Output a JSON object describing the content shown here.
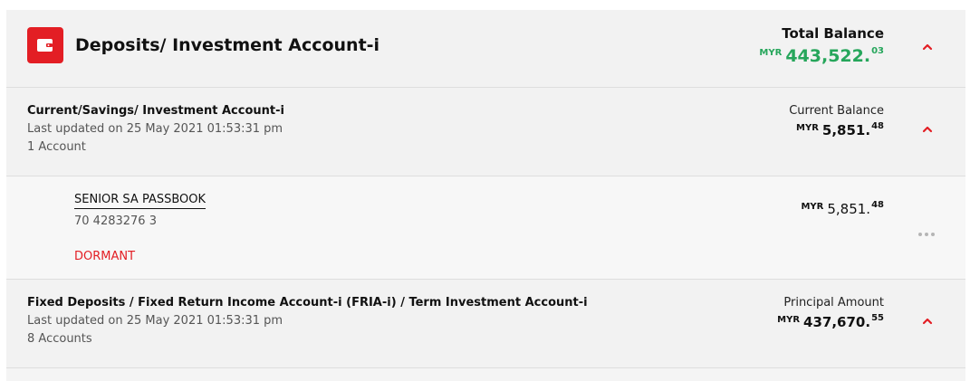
{
  "section": {
    "title": "Deposits/ Investment Account-i",
    "icon": "wallet-icon",
    "total_label": "Total Balance",
    "total_currency": "MYR",
    "total_whole": "443,522.",
    "total_cents": "03",
    "collapse_icon": "chevron-up-icon"
  },
  "casa": {
    "title": "Current/Savings/ Investment Account-i",
    "last_updated": "Last updated on 25 May 2021 01:53:31 pm",
    "count": "1 Account",
    "balance_label": "Current Balance",
    "currency": "MYR",
    "whole": "5,851.",
    "cents": "48"
  },
  "account": {
    "name": "SENIOR SA PASSBOOK",
    "number": "70 4283276 3",
    "status": "DORMANT",
    "currency": "MYR",
    "whole": "5,851.",
    "cents": "48",
    "menu_icon": "more-options-icon"
  },
  "fixed": {
    "title": "Fixed Deposits / Fixed Return Income Account-i (FRIA-i) / Term Investment Account-i",
    "last_updated": "Last updated on 25 May 2021 01:53:31 pm",
    "count": "8 Accounts",
    "balance_label": "Principal Amount",
    "currency": "MYR",
    "whole": "437,670.",
    "cents": "55"
  },
  "colors": {
    "accent_red": "#e31e24",
    "positive_green": "#26a65b",
    "panel_bg": "#f2f2f2"
  }
}
